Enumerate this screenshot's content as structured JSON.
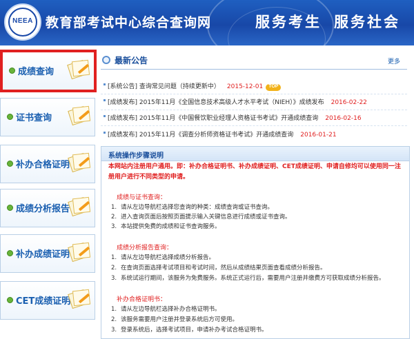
{
  "header": {
    "logo_text": "NEEA",
    "site_title": "教育部考试中心综合查询网",
    "slogan": [
      "服务考生",
      "服务社会"
    ]
  },
  "sidebar": {
    "items": [
      {
        "label": "成绩查询",
        "active": true
      },
      {
        "label": "证书查询",
        "active": false
      },
      {
        "label": "补办合格证明书",
        "active": false
      },
      {
        "label": "成绩分析报告",
        "active": false
      },
      {
        "label": "补办成绩证明",
        "active": false
      },
      {
        "label": "CET成绩证明",
        "active": false
      }
    ]
  },
  "notice": {
    "title": "最新公告",
    "more": "更多",
    "items": [
      {
        "text": "[系统公告] 查询常见问题（持续更新中）",
        "date": "2015-12-01",
        "badge": "TOP"
      },
      {
        "text": "[成绩发布] 2015年11月《全国信息技术高级人才水平考试（NIEH）》成绩发布",
        "date": "2016-02-22",
        "badge": ""
      },
      {
        "text": "[成绩发布] 2015年11月《中国餐饮职业经理人资格证书考试》开通成绩查询",
        "date": "2016-02-16",
        "badge": ""
      },
      {
        "text": "[成绩发布] 2015年11月《调查分析师资格证书考试》开通成绩查询",
        "date": "2016-01-21",
        "badge": ""
      }
    ]
  },
  "steps": {
    "title": "系统操作步骤说明",
    "intro": "本网站内注册用户通用。即：补办合格证明书、补办成绩证明、CET成绩证明、申请自修均可以使用同一注册用户进行不同类型的申请。",
    "sections": [
      {
        "title": "成绩与证书查询：",
        "items": [
          "请从左边导航栏选择您查询的种类：成绩查询或证书查询。",
          "进入查询页面后按照页面提示输入关键信息进行成绩或证书查询。",
          "本站提供免费的成绩和证书查询服务。"
        ]
      },
      {
        "title": "成绩分析报告查询：",
        "items": [
          "请从左边导航栏选择成绩分析报告。",
          "在查询页面选择考试项目和考试时间，然后从成绩结果页面查看成绩分析报告。",
          "系统试运行期间，该服务为免费服务。系统正式运行后，需要用户注册并缴费方可获取成绩分析报告。"
        ]
      },
      {
        "title": "补办合格证明书：",
        "items": [
          "请从左边导航栏选择补办合格证明书。",
          "该服务需要用户注册并登录系统后方可使用。",
          "登录系统后，选择考试项目，申请补办考试合格证明书。"
        ]
      }
    ]
  },
  "colors": {
    "header_blue": "#1848a8",
    "link_blue": "#1a5fb0",
    "alert_red": "#e02020",
    "bullet_green": "#69b43a",
    "badge_orange": "#f2b21a"
  }
}
